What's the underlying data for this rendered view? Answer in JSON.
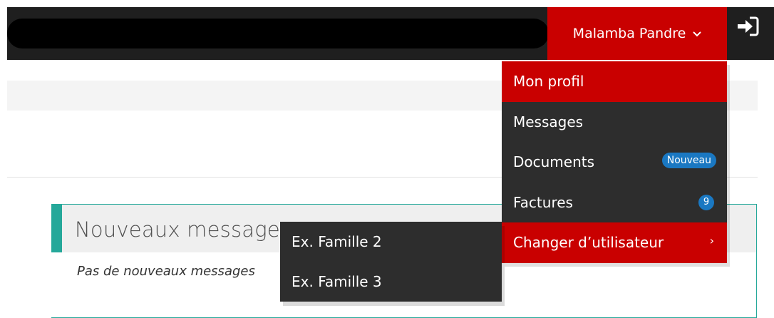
{
  "header": {
    "user_name": "Malamba Pandre",
    "user_chevron": "⌄"
  },
  "dropdown": {
    "items": [
      {
        "label": "Mon profil"
      },
      {
        "label": "Messages"
      },
      {
        "label": "Documents",
        "badge": "Nouveau"
      },
      {
        "label": "Factures",
        "badge": "9"
      },
      {
        "label": "Changer d’utilisateur",
        "arrow": "›"
      }
    ]
  },
  "submenu": {
    "items": [
      {
        "label": "Ex. Famille 2"
      },
      {
        "label": "Ex. Famille 3"
      }
    ]
  },
  "panel": {
    "title": "Nouveaux messages",
    "empty_text": "Pas de nouveaux messages"
  },
  "colors": {
    "brand_red": "#c90000",
    "topbar": "#1f1f1f",
    "menu_dark": "#2d2d2d",
    "badge_blue": "#1a78c2",
    "accent_teal": "#25a89a"
  },
  "icons": [
    "chevron-down-icon",
    "logout-icon",
    "chevron-right-icon"
  ]
}
